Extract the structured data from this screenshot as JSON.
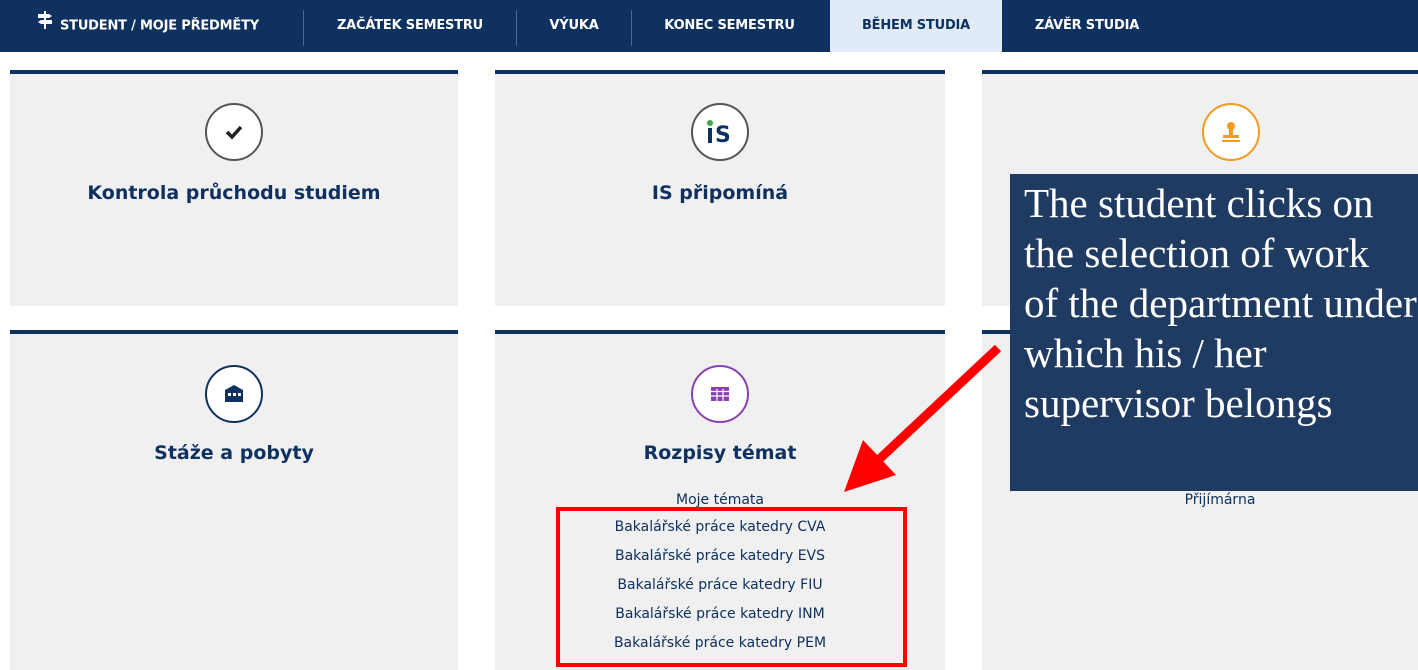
{
  "nav": {
    "tabs": [
      {
        "label": "STUDENT / MOJE PŘEDMĚTY",
        "icon": "signpost-icon"
      },
      {
        "label": "ZAČÁTEK SEMESTRU"
      },
      {
        "label": "VÝUKA"
      },
      {
        "label": "KONEC SEMESTRU"
      },
      {
        "label": "BĚHEM STUDIA",
        "active": true
      },
      {
        "label": "ZÁVĚR STUDIA"
      }
    ],
    "colors": {
      "bar": "#0e3160",
      "active_bg": "#e1ebf8"
    }
  },
  "cards": {
    "study_check": {
      "title": "Kontrola průchodu studiem",
      "icon": "checkmark-icon"
    },
    "is_reminds": {
      "title": "IS připomíná",
      "icon": "is-logo-icon"
    },
    "admissions": {
      "icon": "stamp-icon",
      "links": [
        "Přijímárna"
      ]
    },
    "internships": {
      "title": "Stáže a pobyty",
      "icon": "building-icon"
    },
    "topics": {
      "title": "Rozpisy témat",
      "icon": "table-icon",
      "links": [
        "Moje témata",
        "Bakalářské práce katedry CVA",
        "Bakalářské práce katedry EVS",
        "Bakalářské práce katedry FIU",
        "Bakalářské práce katedry INM",
        "Bakalářské práce katedry PEM"
      ]
    }
  },
  "callout": {
    "lines": [
      "The student clicks on",
      "the selection of work",
      "of the department under",
      "which his / her",
      "supervisor belongs"
    ]
  },
  "annotation_colors": {
    "highlight": "#ff0000",
    "callout_bg": "#1f3b62"
  }
}
